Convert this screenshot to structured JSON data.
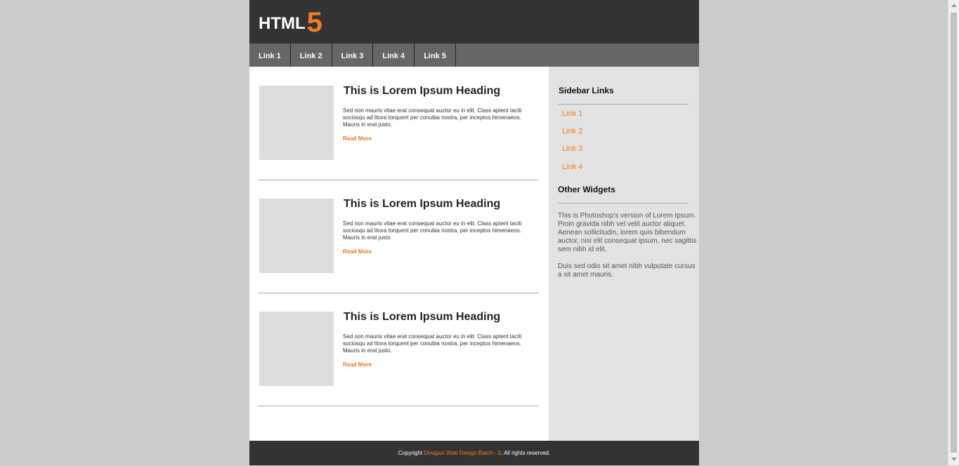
{
  "header": {
    "logo_text": "HTML",
    "logo_number": "5"
  },
  "nav": {
    "items": [
      {
        "label": "Link 1"
      },
      {
        "label": "Link 2"
      },
      {
        "label": "Link 3"
      },
      {
        "label": "Link 4"
      },
      {
        "label": "Link 5"
      }
    ]
  },
  "articles": [
    {
      "heading": "This is Lorem Ipsum Heading",
      "body": "Sed non mauris vitae erat consequat auctor eu in elit. Class aptent taciti sociosqu ad litora torquent per conubia nostra, per inceptos himenaeos. Mauris in erat justo.",
      "read_more": "Read More"
    },
    {
      "heading": "This is Lorem Ipsum Heading",
      "body": "Sed non mauris vitae erat consequat auctor eu in elit. Class aptent taciti sociosqu ad litora torquent per conubia nostra, per inceptos himenaeos. Mauris in erat justo.",
      "read_more": "Read More"
    },
    {
      "heading": "This is Lorem Ipsum Heading",
      "body": "Sed non mauris vitae erat consequat auctor eu in elit. Class aptent taciti sociosqu ad litora torquent per conubia nostra, per inceptos himenaeos. Mauris in erat justo.",
      "read_more": "Read More"
    }
  ],
  "sidebar": {
    "links_title": "Sidebar Links",
    "links": [
      {
        "label": "Link 1"
      },
      {
        "label": "Link 2"
      },
      {
        "label": "Link 3"
      },
      {
        "label": "Link 4"
      }
    ],
    "widgets_title": "Other Widgets",
    "widget_paragraphs": [
      "This is Photoshop's version of Lorem Ipsum. Proin gravida nibh vel velit auctor aliquet. Aenean sollicitudin, lorem quis bibendum auctor, nisi elit consequat ipsum, nec sagittis sem nibh id elit.",
      "Duis sed odio sit amet nibh vulputate cursus a sit amet mauris."
    ]
  },
  "footer": {
    "prefix": "Copyright ",
    "org": "Dinajpur Web Design Batch - 2",
    "suffix": ". All rights reserved."
  },
  "colors": {
    "accent": "#f47b20",
    "header_bg": "#333333",
    "nav_bg": "#666666",
    "sidebar_bg": "#e3e3e3",
    "page_bg": "#cccccc"
  }
}
